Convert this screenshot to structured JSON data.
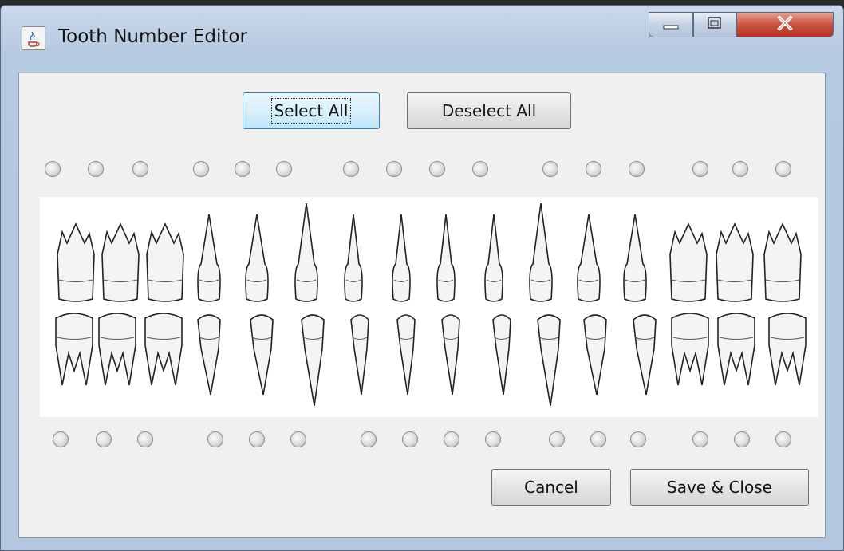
{
  "window": {
    "title": "Tooth Number Editor",
    "icon": "java-coffee-icon",
    "controls": [
      "minimize-icon",
      "maximize-icon",
      "close-icon"
    ]
  },
  "toolbar": {
    "select_all_label": "Select All",
    "deselect_all_label": "Deselect All"
  },
  "upper_teeth_count": 16,
  "lower_teeth_count": 16,
  "footer": {
    "cancel_label": "Cancel",
    "save_close_label": "Save & Close"
  },
  "colors": {
    "close_button": "#c9523f",
    "focus_button": "#bee6fd",
    "panel_bg": "#f0f0f0"
  }
}
